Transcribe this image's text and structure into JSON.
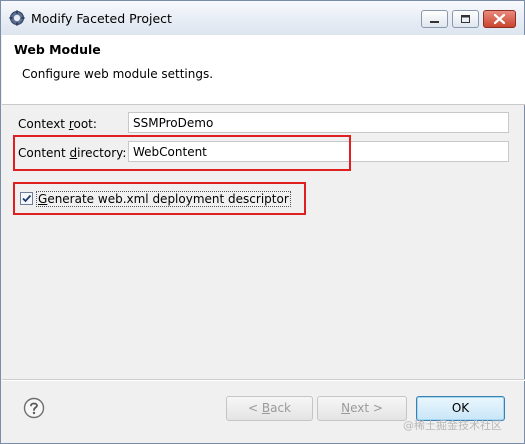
{
  "window": {
    "title": "Modify Faceted Project"
  },
  "header": {
    "title": "Web Module",
    "description": "Configure web module settings."
  },
  "form": {
    "context_root": {
      "label_pre": "Context ",
      "label_mnemonic": "r",
      "label_post": "oot:",
      "value": "SSMProDemo"
    },
    "content_directory": {
      "label_pre": "Content ",
      "label_mnemonic": "d",
      "label_post": "irectory:",
      "value": "WebContent"
    },
    "generate_web_xml": {
      "label_mnemonic": "G",
      "label_post": "enerate web.xml deployment descriptor",
      "checked": true
    }
  },
  "footer": {
    "back_prefix": "< ",
    "back_mnemonic": "B",
    "back_rest": "ack",
    "next_mnemonic": "N",
    "next_rest": "ext >",
    "ok_label": "OK"
  },
  "watermark": "@稀土掘金技术社区",
  "colors": {
    "highlight": "#e02020",
    "ok_border": "#3c7fb1"
  },
  "icons": {
    "app": "eclipse-gear-icon",
    "help": "help-question-icon",
    "check": "checkmark-icon"
  }
}
